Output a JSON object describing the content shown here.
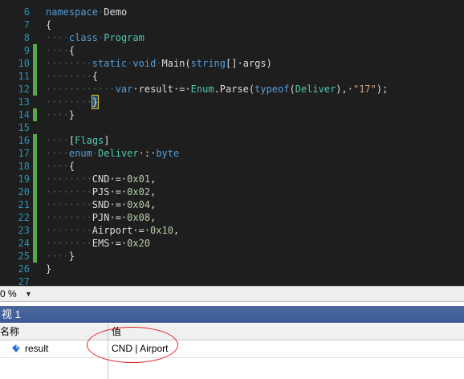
{
  "editor": {
    "lines": [
      {
        "n": "6",
        "segs": [
          {
            "t": "namespace",
            "c": "kw"
          },
          {
            "t": "·",
            "c": "ws"
          },
          {
            "t": "Demo",
            "c": ""
          }
        ]
      },
      {
        "n": "7",
        "segs": [
          {
            "t": "{",
            "c": ""
          }
        ]
      },
      {
        "n": "8",
        "segs": [
          {
            "t": "····",
            "c": "ws"
          },
          {
            "t": "class",
            "c": "kw"
          },
          {
            "t": "·",
            "c": "ws"
          },
          {
            "t": "Program",
            "c": "ty"
          }
        ]
      },
      {
        "n": "9",
        "segs": [
          {
            "t": "····",
            "c": "ws"
          },
          {
            "t": "{",
            "c": ""
          }
        ]
      },
      {
        "n": "10",
        "segs": [
          {
            "t": "········",
            "c": "ws"
          },
          {
            "t": "static",
            "c": "kw"
          },
          {
            "t": "·",
            "c": "ws"
          },
          {
            "t": "void",
            "c": "kw"
          },
          {
            "t": "·",
            "c": "ws"
          },
          {
            "t": "Main(",
            "c": ""
          },
          {
            "t": "string",
            "c": "kw"
          },
          {
            "t": "[]·args)",
            "c": ""
          }
        ]
      },
      {
        "n": "11",
        "segs": [
          {
            "t": "········",
            "c": "ws"
          },
          {
            "t": "{",
            "c": ""
          }
        ]
      },
      {
        "n": "12",
        "segs": [
          {
            "t": "············",
            "c": "ws"
          },
          {
            "t": "var",
            "c": "kw"
          },
          {
            "t": "·result·=·",
            "c": ""
          },
          {
            "t": "Enum",
            "c": "ty"
          },
          {
            "t": ".Parse(",
            "c": ""
          },
          {
            "t": "typeof",
            "c": "kw"
          },
          {
            "t": "(",
            "c": ""
          },
          {
            "t": "Deliver",
            "c": "ty"
          },
          {
            "t": "),·",
            "c": ""
          },
          {
            "t": "\"17\"",
            "c": "str"
          },
          {
            "t": ");",
            "c": ""
          }
        ]
      },
      {
        "n": "13",
        "segs": [
          {
            "t": "········",
            "c": "ws"
          },
          {
            "t": "}",
            "c": "caret"
          }
        ]
      },
      {
        "n": "14",
        "segs": [
          {
            "t": "····",
            "c": "ws"
          },
          {
            "t": "}",
            "c": ""
          }
        ]
      },
      {
        "n": "15",
        "segs": []
      },
      {
        "n": "16",
        "segs": [
          {
            "t": "····",
            "c": "ws"
          },
          {
            "t": "[",
            "c": ""
          },
          {
            "t": "Flags",
            "c": "ty"
          },
          {
            "t": "]",
            "c": ""
          }
        ]
      },
      {
        "n": "17",
        "segs": [
          {
            "t": "····",
            "c": "ws"
          },
          {
            "t": "enum",
            "c": "kw"
          },
          {
            "t": "·",
            "c": "ws"
          },
          {
            "t": "Deliver",
            "c": "ty"
          },
          {
            "t": "·:·",
            "c": ""
          },
          {
            "t": "byte",
            "c": "kw"
          }
        ]
      },
      {
        "n": "18",
        "segs": [
          {
            "t": "····",
            "c": "ws"
          },
          {
            "t": "{",
            "c": ""
          }
        ]
      },
      {
        "n": "19",
        "segs": [
          {
            "t": "········",
            "c": "ws"
          },
          {
            "t": "CND·=·",
            "c": ""
          },
          {
            "t": "0x01",
            "c": "num"
          },
          {
            "t": ",",
            "c": ""
          }
        ]
      },
      {
        "n": "20",
        "segs": [
          {
            "t": "········",
            "c": "ws"
          },
          {
            "t": "PJS·=·",
            "c": ""
          },
          {
            "t": "0x02",
            "c": "num"
          },
          {
            "t": ",",
            "c": ""
          }
        ]
      },
      {
        "n": "21",
        "segs": [
          {
            "t": "········",
            "c": "ws"
          },
          {
            "t": "SND·=·",
            "c": ""
          },
          {
            "t": "0x04",
            "c": "num"
          },
          {
            "t": ",",
            "c": ""
          }
        ]
      },
      {
        "n": "22",
        "segs": [
          {
            "t": "········",
            "c": "ws"
          },
          {
            "t": "PJN·=·",
            "c": ""
          },
          {
            "t": "0x08",
            "c": "num"
          },
          {
            "t": ",",
            "c": ""
          }
        ]
      },
      {
        "n": "23",
        "segs": [
          {
            "t": "········",
            "c": "ws"
          },
          {
            "t": "Airport·=·",
            "c": ""
          },
          {
            "t": "0x10",
            "c": "num"
          },
          {
            "t": ",",
            "c": ""
          }
        ]
      },
      {
        "n": "24",
        "segs": [
          {
            "t": "········",
            "c": "ws"
          },
          {
            "t": "EMS·=·",
            "c": ""
          },
          {
            "t": "0x20",
            "c": "num"
          }
        ]
      },
      {
        "n": "25",
        "segs": [
          {
            "t": "····",
            "c": "ws"
          },
          {
            "t": "}",
            "c": ""
          }
        ]
      },
      {
        "n": "26",
        "segs": [
          {
            "t": "}",
            "c": ""
          }
        ]
      },
      {
        "n": "27",
        "segs": [
          {
            "t": "",
            "c": ""
          }
        ]
      }
    ],
    "changed_lines": [
      "9",
      "10",
      "11",
      "12",
      "14",
      "16",
      "17",
      "18",
      "19",
      "20",
      "21",
      "22",
      "23",
      "24",
      "25"
    ],
    "colors": {
      "changed_bar": "#57a64a"
    }
  },
  "statusbar": {
    "zoom": "0 %"
  },
  "watch": {
    "title": "视 1",
    "col_name": "名称",
    "col_value": "值",
    "row": {
      "name": "result",
      "value": "CND | Airport",
      "icon": "field-icon"
    }
  },
  "annotation": {
    "color": "#e02020"
  }
}
